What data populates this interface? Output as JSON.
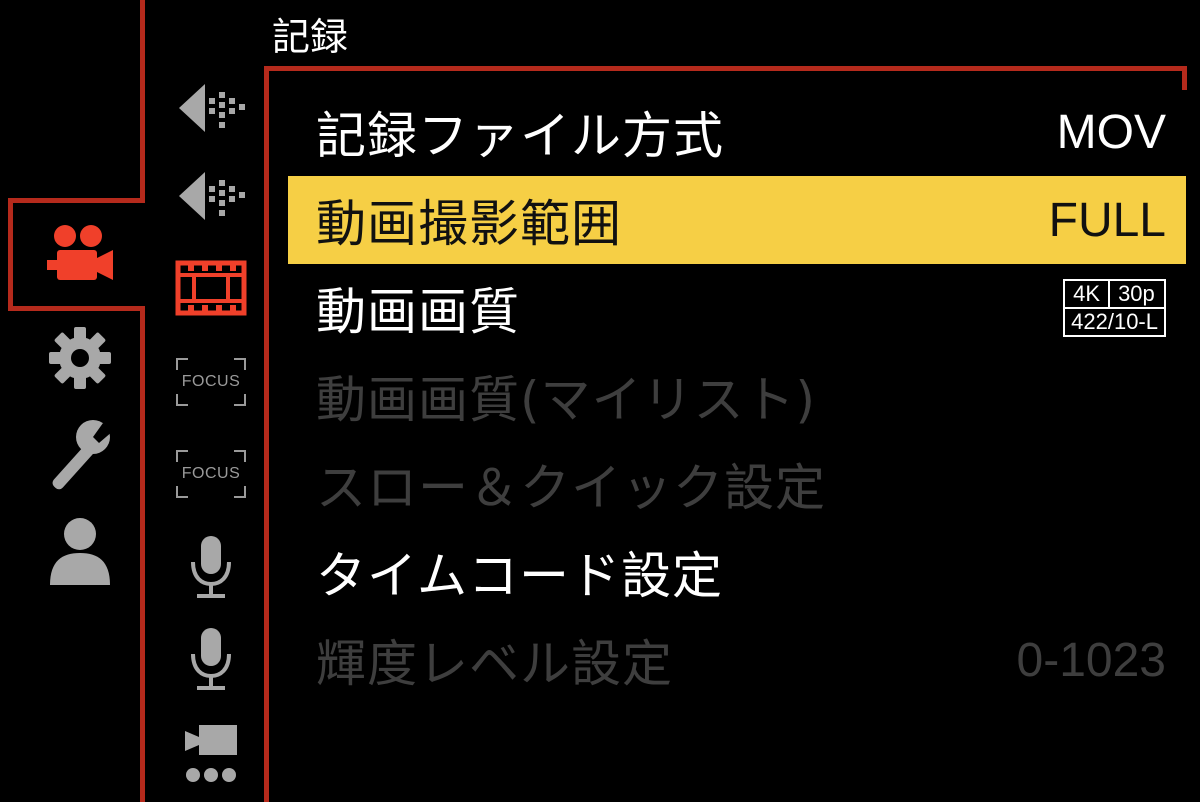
{
  "header": {
    "title": "記録"
  },
  "categories": [
    {
      "icon": "movie-camera-icon",
      "active": true
    },
    {
      "icon": "gear-icon",
      "active": false
    },
    {
      "icon": "wrench-icon",
      "active": false
    },
    {
      "icon": "user-icon",
      "active": false
    }
  ],
  "sub_tabs": {
    "focus_label_1": "FOCUS",
    "focus_label_2": "FOCUS"
  },
  "menu": {
    "items": [
      {
        "label": "記録ファイル方式",
        "value": "MOV",
        "state": "normal"
      },
      {
        "label": "動画撮影範囲",
        "value": "FULL",
        "state": "selected"
      },
      {
        "label": "動画画質",
        "value": "",
        "state": "normal"
      },
      {
        "label": "動画画質(マイリスト)",
        "value": "",
        "state": "disabled"
      },
      {
        "label": "スロー＆クイック設定",
        "value": "",
        "state": "disabled"
      },
      {
        "label": "タイムコード設定",
        "value": "",
        "state": "normal"
      },
      {
        "label": "輝度レベル設定",
        "value": "0-1023",
        "state": "disabled"
      }
    ],
    "quality_badge": {
      "resolution": "4K",
      "frame_rate": "30p",
      "codec": "422/10-L"
    }
  },
  "colors": {
    "accent_red": "#b52a1c",
    "active_icon": "#f0402a",
    "highlight": "#f6cf45",
    "disabled_text": "#3e3e3e"
  }
}
